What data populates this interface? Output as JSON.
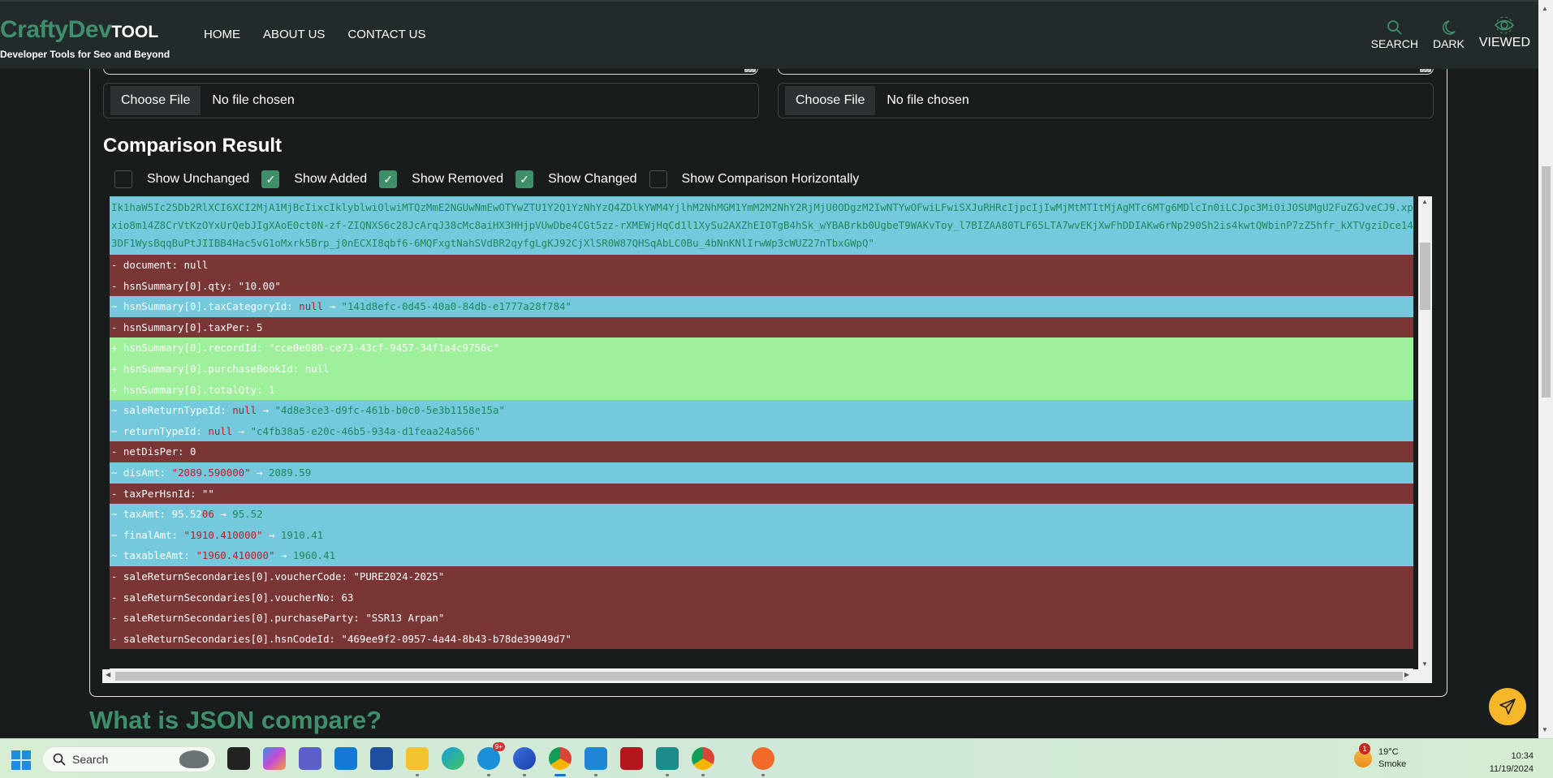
{
  "header": {
    "logo_main": "CraftyDev",
    "logo_tool": "TOOL",
    "tagline": "Developer Tools for Seo and Beyond",
    "nav": [
      "HOME",
      "ABOUT US",
      "CONTACT US"
    ],
    "actions": {
      "search": "SEARCH",
      "dark": "DARK",
      "viewed": "VIEWED"
    }
  },
  "inputs": {
    "left": {
      "button": "Choose File",
      "status": "No file chosen"
    },
    "right": {
      "button": "Choose File",
      "status": "No file chosen"
    }
  },
  "result": {
    "title": "Comparison Result",
    "options": [
      {
        "label": "Show Unchanged",
        "checked": false
      },
      {
        "label": "Show Added",
        "checked": true
      },
      {
        "label": "Show Removed",
        "checked": true
      },
      {
        "label": "Show Changed",
        "checked": true
      },
      {
        "label": "Show Comparison Horizontally",
        "checked": false
      }
    ],
    "token_text": "Ik1haW5Ic25Db2RlXCI6XCI2MjA1MjBcIixcIklyblwiOlwiMTQzMmE2NGUwNmEwOTYwZTU1Y2Q1YzNhYzQ4ZDlkYWM4YjlhM2NhMGM1YmM2M2NhY2RjMjU0ODgzM2IwNTYwOFwiLFwiSXJuRHRcIjpcIjIwMjMtMTItMjAgMTc6MTg6MDlcIn0iLCJpc3MiOiJOSUMgU2FuZGJveCJ9.xpxio8m14Z8CrVtKzOYxUrQebJIgXAoE0ct0N-zf-ZIQNXS6c28JcArqJ38cMc8aiHX3HHjpVUwDbe4CGt5zz-rXMEWjHqCd1l1XySu2AXZhEIOTgB4hSk_wYBABrkb0UgbeT9WAKvToy_l7BIZAA80TLF65LTA7wvEKjXwFhDDIAKw6rNp290Sh2is4kwtQWbinP7zZ5hfr_kXTVgziDce143DF1WysBqqBuPtJIIBB4Hac5vG1oMxrk5Brp_j0nECXI8qbf6-6MQFxgtNahSVdBR2qyfgLgKJ92CjXlSR0W87QHSqAbLC0Bu_4bNnKNlIrwWp3cWUZ27nTbxGWpQ\"",
    "lines": [
      {
        "type": "removed",
        "prefix": "-",
        "key": "document",
        "value": "null"
      },
      {
        "type": "removed",
        "prefix": "-",
        "key": "hsnSummary[0].qty",
        "value": "\"10.00\""
      },
      {
        "type": "changed",
        "prefix": "~",
        "key": "hsnSummary[0].taxCategoryId",
        "old": "null",
        "new": "\"141d8efc-0d45-40a0-84db-e1777a28f784\""
      },
      {
        "type": "removed",
        "prefix": "-",
        "key": "hsnSummary[0].taxPer",
        "value": "5"
      },
      {
        "type": "added",
        "prefix": "+",
        "key": "hsnSummary[0].recordId",
        "value": "\"cce0e080-ce73-43cf-9457-34f1a4c9756c\""
      },
      {
        "type": "added",
        "prefix": "+",
        "key": "hsnSummary[0].purchaseBookId",
        "value": "null"
      },
      {
        "type": "added",
        "prefix": "+",
        "key": "hsnSummary[0].totalQty",
        "value": "1"
      },
      {
        "type": "changed",
        "prefix": "~",
        "key": "saleReturnTypeId",
        "old": "null",
        "new": "\"4d8e3ce3-d9fc-461b-b0c0-5e3b1158e15a\""
      },
      {
        "type": "changed",
        "prefix": "~",
        "key": "returnTypeId",
        "old": "null",
        "new": "\"c4fb38a5-e20c-46b5-934a-d1feaa24a566\""
      },
      {
        "type": "removed",
        "prefix": "-",
        "key": "netDisPer",
        "value": "0"
      },
      {
        "type": "changed",
        "prefix": "~",
        "key": "disAmt",
        "old": "\"2089.590000\"",
        "new": "2089.59"
      },
      {
        "type": "removed",
        "prefix": "-",
        "key": "taxPerHsnId",
        "value": "\"\""
      },
      {
        "type": "changed",
        "prefix": "~",
        "key": "taxAmt",
        "old_common": "95.52",
        "old": "06",
        "new": "95.52",
        "inline": true
      },
      {
        "type": "changed",
        "prefix": "~",
        "key": "finalAmt",
        "old": "\"1910.410000\"",
        "new": "1910.41"
      },
      {
        "type": "changed",
        "prefix": "~",
        "key": "taxableAmt",
        "old": "\"1960.410000\"",
        "new": "1960.41"
      },
      {
        "type": "removed",
        "prefix": "-",
        "key": "saleReturnSecondaries[0].voucherCode",
        "value": "\"PURE2024-2025\""
      },
      {
        "type": "removed",
        "prefix": "-",
        "key": "saleReturnSecondaries[0].voucherNo",
        "value": "63"
      },
      {
        "type": "removed",
        "prefix": "-",
        "key": "saleReturnSecondaries[0].purchaseParty",
        "value": "\"SSR13 Arpan\""
      },
      {
        "type": "removed",
        "prefix": "-",
        "key": "saleReturnSecondaries[0].hsnCodeId",
        "value": "\"469ee9f2-0957-4a44-8b43-b78de39049d7\""
      }
    ]
  },
  "section_heading": "What is JSON compare?",
  "colors": {
    "accent": "#3f8f6a",
    "changed": "#74c9dd",
    "removed": "#7a3535",
    "added": "#9ef09b",
    "fab": "#f6b72a"
  },
  "taskbar": {
    "search_placeholder": "Search",
    "apps": [
      "task-view",
      "copilot",
      "teams",
      "mail",
      "store",
      "file-explorer",
      "edge",
      "skype",
      "firefox",
      "chrome",
      "vscode",
      "filezilla",
      "clock-app",
      "chrome-profile",
      "paint-app"
    ],
    "skype_badge": "9+",
    "weather": {
      "temp": "19°C",
      "condition": "Smoke",
      "badge": "1"
    },
    "time": "10:34",
    "date": "11/19/2024"
  }
}
